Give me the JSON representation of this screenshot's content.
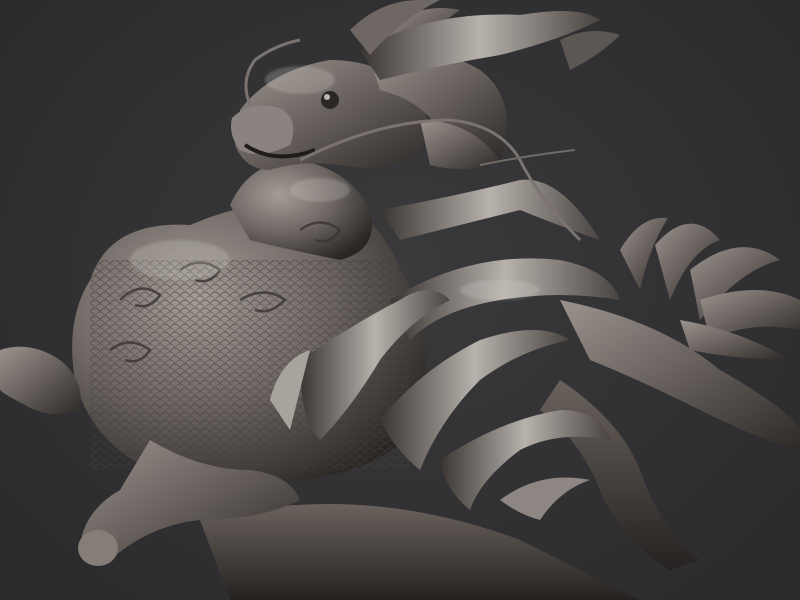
{
  "scene": {
    "background_color": "#333335",
    "material_color": "#6e6763",
    "highlight_color": "#c9c4bf",
    "shadow_color": "#1c1a19",
    "subject": "dragon-sculpt"
  }
}
